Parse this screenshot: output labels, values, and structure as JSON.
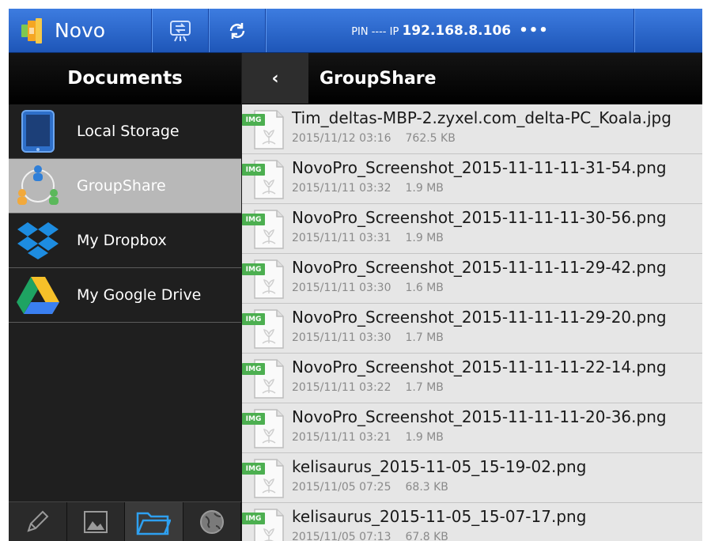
{
  "top_bar": {
    "app_name": "Novo",
    "pin_label": "PIN ---- IP",
    "ip_address": "192.168.8.106",
    "more": "•••",
    "icons": [
      "novo-logo-icon",
      "screen-share-icon",
      "refresh-icon"
    ]
  },
  "sidebar": {
    "title": "Documents",
    "items": [
      {
        "label": "Local Storage",
        "icon": "tablet-icon",
        "active": false
      },
      {
        "label": "GroupShare",
        "icon": "group-share-icon",
        "active": true
      },
      {
        "label": "My Dropbox",
        "icon": "dropbox-icon",
        "active": false
      },
      {
        "label": "My Google Drive",
        "icon": "google-drive-icon",
        "active": false
      }
    ],
    "bottom_tabs": [
      "pencil-icon",
      "image-icon",
      "folder-icon",
      "globe-icon"
    ],
    "active_tab": "folder-icon"
  },
  "main": {
    "back": "‹",
    "folder_title": "GroupShare",
    "file_badge": "IMG",
    "files": [
      {
        "name": "Tim_deltas-MBP-2.zyxel.com_delta-PC_Koala.jpg",
        "date": "2015/11/12 03:16",
        "size": "762.5 KB"
      },
      {
        "name": "NovoPro_Screenshot_2015-11-11-11-31-54.png",
        "date": "2015/11/11 03:32",
        "size": "1.9 MB"
      },
      {
        "name": "NovoPro_Screenshot_2015-11-11-11-30-56.png",
        "date": "2015/11/11 03:31",
        "size": "1.9 MB"
      },
      {
        "name": "NovoPro_Screenshot_2015-11-11-11-29-42.png",
        "date": "2015/11/11 03:30",
        "size": "1.6 MB"
      },
      {
        "name": "NovoPro_Screenshot_2015-11-11-11-29-20.png",
        "date": "2015/11/11 03:30",
        "size": "1.7 MB"
      },
      {
        "name": "NovoPro_Screenshot_2015-11-11-11-22-14.png",
        "date": "2015/11/11 03:22",
        "size": "1.7 MB"
      },
      {
        "name": "NovoPro_Screenshot_2015-11-11-11-20-36.png",
        "date": "2015/11/11 03:21",
        "size": "1.9 MB"
      },
      {
        "name": "kelisaurus_2015-11-05_15-19-02.png",
        "date": "2015/11/05 07:25",
        "size": "68.3 KB"
      },
      {
        "name": "kelisaurus_2015-11-05_15-07-17.png",
        "date": "2015/11/05 07:13",
        "size": "67.8 KB"
      }
    ]
  },
  "colors": {
    "top_bar": "#2a66cc",
    "sidebar_bg": "#1f1f1f",
    "active_item": "#b8b8b8",
    "file_list_bg": "#e6e6e6",
    "img_badge": "#4caf50",
    "active_tab_icon": "#2ea0f0"
  }
}
